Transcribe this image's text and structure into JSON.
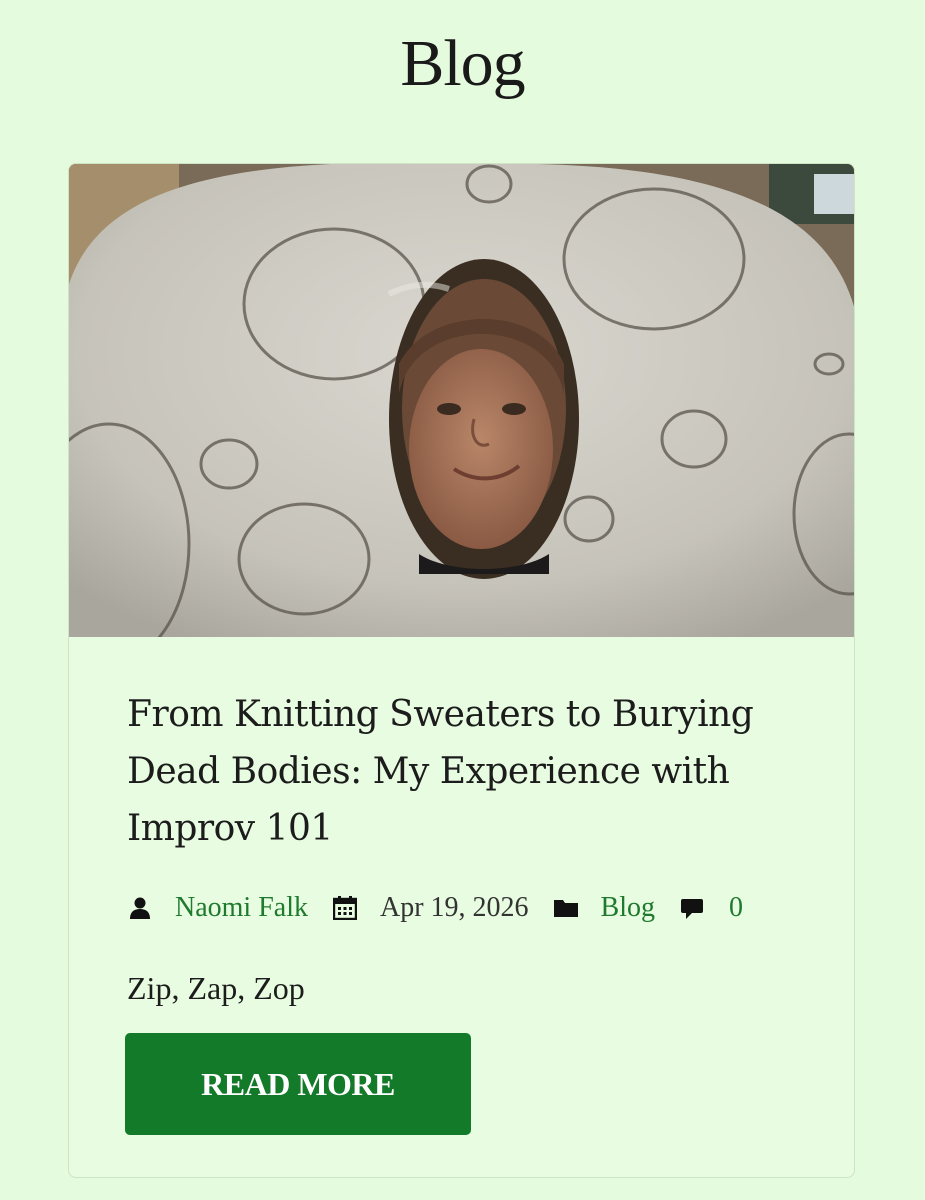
{
  "page": {
    "title": "Blog"
  },
  "post": {
    "image_alt": "Child wearing a large white bagel costume",
    "title": "From Knitting Sweaters to Burying Dead Bodies: My Experience with Improv 101",
    "meta": {
      "author": "Naomi Falk",
      "author_icon": "user-icon",
      "date": "Apr 19, 2026",
      "date_icon": "calendar-icon",
      "category": "Blog",
      "category_icon": "folder-icon",
      "comments": "0",
      "comments_icon": "comment-icon"
    },
    "excerpt": "Zip, Zap, Zop",
    "read_more_label": "READ MORE"
  },
  "colors": {
    "background": "#e5fbdd",
    "card_background": "#e7fce0",
    "accent_green": "#137a2a",
    "link_green": "#1f7a2e",
    "text": "#1c1c1c"
  }
}
